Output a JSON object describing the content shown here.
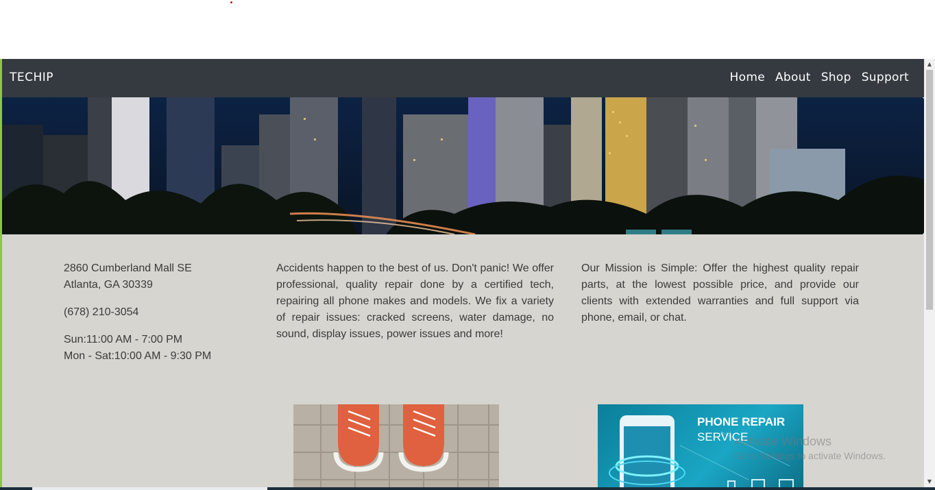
{
  "nav": {
    "brand": "TECHIP",
    "links": [
      "Home",
      "About",
      "Shop",
      "Support"
    ]
  },
  "contact": {
    "address_line1": "2860 Cumberland Mall SE",
    "address_line2": "Atlanta, GA 30339",
    "phone": "(678) 210-3054",
    "hours_sunday": "Sun:11:00 AM - 7:00 PM",
    "hours_weekdays": "Mon - Sat:10:00 AM - 9:30 PM"
  },
  "about_text": "Accidents happen to the best of us. Don't panic! We offer professional, quality repair done by a certified tech, repairing all phone makes and models. We fix a variety of repair issues: cracked screens, water damage, no sound, display issues, power issues and more!",
  "mission_text": "Our Mission is Simple: Offer the highest quality repair parts, at the lowest possible price, and provide our clients with extended warranties and full support via phone, email, or chat.",
  "promo": {
    "phone_banner_line1": "PHONE REPAIR",
    "phone_banner_line2": "SERVICE"
  },
  "watermark": {
    "line1": "Activate Windows",
    "line2": "Go to Settings to activate Windows."
  },
  "colors": {
    "navbar": "#343a40",
    "content_bg": "#d6d5d0",
    "frame_accent": "#8dc63f"
  }
}
